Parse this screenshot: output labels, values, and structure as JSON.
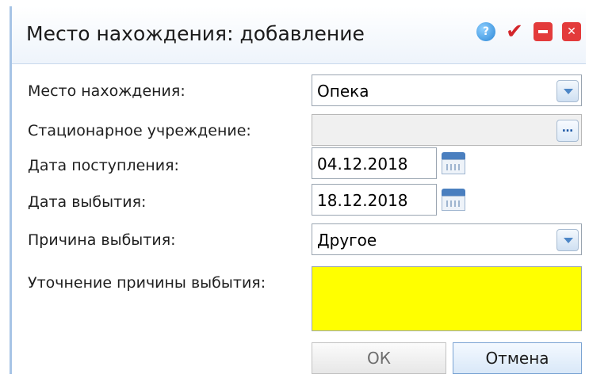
{
  "window": {
    "title": "Место нахождения: добавление",
    "icons": [
      "help-icon",
      "check-icon",
      "minimize-icon",
      "close-icon"
    ]
  },
  "form": {
    "location_label": "Место нахождения:",
    "location_value": "Опека",
    "institution_label": "Стационарное учреждение:",
    "institution_value": "",
    "arrival_date_label": "Дата поступления:",
    "arrival_date_value": "04.12.2018",
    "departure_date_label": "Дата выбытия:",
    "departure_date_value": "18.12.2018",
    "reason_label": "Причина выбытия:",
    "reason_value": "Другое",
    "reason_details_label": "Уточнение причины выбытия:",
    "reason_details_value": ""
  },
  "buttons": {
    "ok_label": "ОК",
    "cancel_label": "Отмена"
  },
  "colors": {
    "highlight_field": "#ffff00",
    "window_border": "#a7c4e6"
  }
}
